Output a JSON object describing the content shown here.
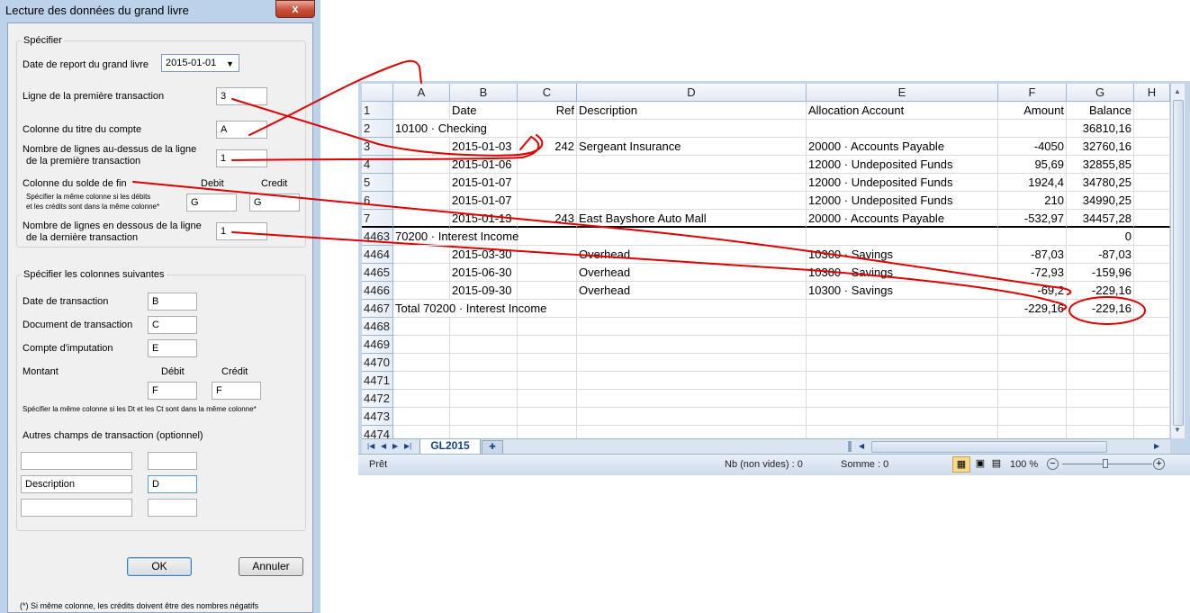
{
  "dialog": {
    "title": "Lecture des données du grand livre",
    "close_glyph": "x",
    "specifier": {
      "group_label": "Spécifier",
      "report_date_label": "Date de report du grand livre",
      "report_date_value": "2015-01-01",
      "first_row_label": "Ligne de la première transaction",
      "first_row_value": "3",
      "account_title_col_label": "Colonne du titre du compte",
      "account_title_col_value": "A",
      "rows_above_label_1": "Nombre de lignes au-dessus de la ligne",
      "rows_above_label_2": "de la première transaction",
      "rows_above_value": "1",
      "end_balance_label": "Colonne du solde de fin",
      "debit_header": "Debit",
      "credit_header": "Credit",
      "end_balance_note_1": "Spécifier la même colonne si les débits",
      "end_balance_note_2": "et les crédits sont dans la même colonne*",
      "end_balance_debit_value": "G",
      "end_balance_credit_value": "G",
      "rows_below_label_1": "Nombre de lignes en dessous de la ligne",
      "rows_below_label_2": "de la dernière transaction",
      "rows_below_value": "1"
    },
    "columns": {
      "group_label": "Spécifier les colonnes suivantes",
      "date_label": "Date de transaction",
      "date_value": "B",
      "doc_label": "Document de transaction",
      "doc_value": "C",
      "account_label": "Compte d'imputation",
      "account_value": "E",
      "amount_label": "Montant",
      "debit_header": "Débit",
      "credit_header": "Crédit",
      "amount_debit_value": "F",
      "amount_credit_value": "F",
      "same_col_note": "Spécifier la même colonne si les Dt et les Ct sont dans la même colonne*",
      "other_fields_label": "Autres champs de transaction (optionnel)",
      "other_fields": [
        {
          "name": "",
          "col": ""
        },
        {
          "name": "Description",
          "col": "D"
        },
        {
          "name": "",
          "col": ""
        }
      ]
    },
    "ok_label": "OK",
    "cancel_label": "Annuler",
    "footnote": "(*) Si même colonne, les crédits doivent être des nombres négatifs"
  },
  "excel": {
    "column_headers": [
      "A",
      "B",
      "C",
      "D",
      "E",
      "F",
      "G",
      "H"
    ],
    "rows": [
      {
        "num": "1",
        "a": "",
        "b": "Date",
        "c": "Ref",
        "d": "Description",
        "e": "Allocation Account",
        "f": "Amount",
        "g": "Balance"
      },
      {
        "num": "2",
        "a": "10100 · Checking",
        "b": "",
        "c": "",
        "d": "",
        "e": "",
        "f": "",
        "g": "36810,16"
      },
      {
        "num": "3",
        "a": "",
        "b": "2015-01-03",
        "c": "242",
        "d": "Sergeant Insurance",
        "e": "20000 · Accounts Payable",
        "f": "-4050",
        "g": "32760,16"
      },
      {
        "num": "4",
        "a": "",
        "b": "2015-01-06",
        "c": "",
        "d": "",
        "e": "12000 · Undeposited Funds",
        "f": "95,69",
        "g": "32855,85"
      },
      {
        "num": "5",
        "a": "",
        "b": "2015-01-07",
        "c": "",
        "d": "",
        "e": "12000 · Undeposited Funds",
        "f": "1924,4",
        "g": "34780,25"
      },
      {
        "num": "6",
        "a": "",
        "b": "2015-01-07",
        "c": "",
        "d": "",
        "e": "12000 · Undeposited Funds",
        "f": "210",
        "g": "34990,25"
      },
      {
        "num": "7",
        "a": "",
        "b": "2015-01-13",
        "c": "243",
        "d": "East Bayshore Auto Mall",
        "e": "20000 · Accounts Payable",
        "f": "-532,97",
        "g": "34457,28"
      },
      {
        "num": "4463",
        "a": "70200 · Interest Income",
        "b": "",
        "c": "",
        "d": "",
        "e": "",
        "f": "",
        "g": "0"
      },
      {
        "num": "4464",
        "a": "",
        "b": "2015-03-30",
        "c": "",
        "d": "Overhead",
        "e": "10300 · Savings",
        "f": "-87,03",
        "g": "-87,03"
      },
      {
        "num": "4465",
        "a": "",
        "b": "2015-06-30",
        "c": "",
        "d": "Overhead",
        "e": "10300 · Savings",
        "f": "-72,93",
        "g": "-159,96"
      },
      {
        "num": "4466",
        "a": "",
        "b": "2015-09-30",
        "c": "",
        "d": "Overhead",
        "e": "10300 · Savings",
        "f": "-69,2",
        "g": "-229,16"
      },
      {
        "num": "4467",
        "a": "Total 70200 · Interest Income",
        "b": "",
        "c": "",
        "d": "",
        "e": "",
        "f": "-229,16",
        "g": "-229,16"
      },
      {
        "num": "4468",
        "a": "",
        "b": "",
        "c": "",
        "d": "",
        "e": "",
        "f": "",
        "g": ""
      },
      {
        "num": "4469",
        "a": "",
        "b": "",
        "c": "",
        "d": "",
        "e": "",
        "f": "",
        "g": ""
      },
      {
        "num": "4470",
        "a": "",
        "b": "",
        "c": "",
        "d": "",
        "e": "",
        "f": "",
        "g": ""
      },
      {
        "num": "4471",
        "a": "",
        "b": "",
        "c": "",
        "d": "",
        "e": "",
        "f": "",
        "g": ""
      },
      {
        "num": "4472",
        "a": "",
        "b": "",
        "c": "",
        "d": "",
        "e": "",
        "f": "",
        "g": ""
      },
      {
        "num": "4473",
        "a": "",
        "b": "",
        "c": "",
        "d": "",
        "e": "",
        "f": "",
        "g": ""
      },
      {
        "num": "4474",
        "a": "",
        "b": "",
        "c": "",
        "d": "",
        "e": "",
        "f": "",
        "g": ""
      }
    ],
    "sheet_tab": "GL2015",
    "status": {
      "ready": "Prêt",
      "count": "Nb (non vides) : 0",
      "sum": "Somme : 0",
      "zoom": "100 %"
    }
  },
  "colors": {
    "annotation": "#e00000",
    "dialog_frame": "#bcd2ea",
    "excel_frame": "#c5d5ea"
  }
}
